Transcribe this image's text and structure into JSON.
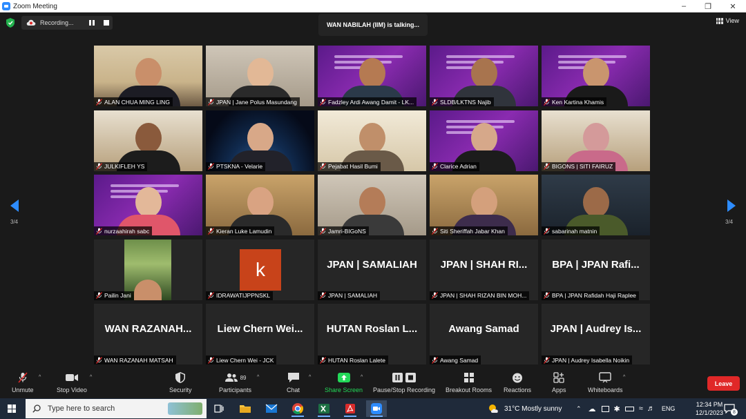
{
  "window": {
    "title": "Zoom Meeting",
    "controls": [
      "–",
      "❐",
      "✕"
    ]
  },
  "top": {
    "recording_label": "Recording...",
    "talking_label": "WAN NABILAH (IIM) is talking...",
    "view_label": "View",
    "page_indicator": "3/4"
  },
  "tiles": [
    {
      "name": "ALAN CHUA MING LING",
      "style": "office",
      "skin": "#c98f6a",
      "shirt": "#1c1c24"
    },
    {
      "name": "JPAN | Jane Polus Masundang",
      "style": "beige",
      "skin": "#e2b896",
      "shirt": "#2a2a2a"
    },
    {
      "name": "Fadzley Ardi Awang Damit - LK...",
      "style": "purple",
      "skin": "#b57a52",
      "shirt": "#2b3a4a"
    },
    {
      "name": "SLDB/LKTNS Najib",
      "style": "purple",
      "skin": "#a8744e",
      "shirt": "#30343c"
    },
    {
      "name": "Ken Kartina Khamis",
      "style": "purple",
      "skin": "#c9956e",
      "shirt": "#1a1a1a"
    },
    {
      "name": "JULKIFLEH YS",
      "style": "room",
      "skin": "#8a5a3c",
      "shirt": "#1c1c1c"
    },
    {
      "name": "PTSKNA - Velarie",
      "style": "earth",
      "skin": "#d8a888",
      "shirt": "#22222a"
    },
    {
      "name": "Pejabat Hasil Bumi",
      "style": "bright",
      "skin": "#c08f6a",
      "shirt": "#6a5a48"
    },
    {
      "name": "Clarice Adrian",
      "style": "purple",
      "skin": "#d6a88a",
      "shirt": "#1c1c1c"
    },
    {
      "name": "BIGONS | SITI FAIRUZ",
      "style": "room",
      "skin": "#d49a9a",
      "shirt": "#c96a8a"
    },
    {
      "name": "nurzaahirah sabc",
      "style": "purple",
      "skin": "#e3b899",
      "shirt": "#e0566a"
    },
    {
      "name": "Kieran Luke Lamudin",
      "style": "warm",
      "skin": "#d9a382",
      "shirt": "#2a2a2a"
    },
    {
      "name": "Jamri-BIGoNS",
      "style": "beige",
      "skin": "#b47c58",
      "shirt": "#3a3a3a"
    },
    {
      "name": "Siti Sheriffah Jabar Khan",
      "style": "warm",
      "skin": "#d4a07c",
      "shirt": "#3d2c4c"
    },
    {
      "name": "sabarinah matnin",
      "style": "dark",
      "skin": "#9c6a48",
      "shirt": "#4a5a2a"
    }
  ],
  "placeholder_tiles": [
    {
      "display": "",
      "name": "Pailin Jani",
      "kind": "photo"
    },
    {
      "display": "k",
      "name": "IDRAWATIJPPNSKL",
      "kind": "letter"
    },
    {
      "display": "JPAN | SAMALIAH",
      "name": "JPAN | SAMALIAH",
      "kind": "text"
    },
    {
      "display": "JPAN | SHAH RI...",
      "name": "JPAN | SHAH RIZAN BIN MOH...",
      "kind": "text"
    },
    {
      "display": "BPA | JPAN Rafi...",
      "name": "BPA | JPAN Rafidah Haji Raplee",
      "kind": "text"
    },
    {
      "display": "WAN  RAZANAH...",
      "name": "WAN RAZANAH MATSAH",
      "kind": "text"
    },
    {
      "display": "Liew Chern Wei...",
      "name": "Liew Chern Wei - JCK",
      "kind": "text"
    },
    {
      "display": "HUTAN Roslan L...",
      "name": "HUTAN Roslan Lalete",
      "kind": "text"
    },
    {
      "display": "Awang Samad",
      "name": "Awang Samad",
      "kind": "text"
    },
    {
      "display": "JPAN | Audrey Is...",
      "name": "JPAN | Audrey Isabella Noikin",
      "kind": "text"
    }
  ],
  "toolbar": {
    "unmute": "Unmute",
    "stop_video": "Stop Video",
    "security": "Security",
    "participants": "Participants",
    "participants_count": "89",
    "chat": "Chat",
    "share_screen": "Share Screen",
    "pause_stop_recording": "Pause/Stop Recording",
    "breakout_rooms": "Breakout Rooms",
    "reactions": "Reactions",
    "apps": "Apps",
    "whiteboards": "Whiteboards",
    "leave": "Leave"
  },
  "taskbar": {
    "search_placeholder": "Type here to search",
    "weather": "31°C  Mostly sunny",
    "language": "ENG",
    "time": "12:34 PM",
    "date": "12/1/2023",
    "notification_count": "8"
  },
  "colors": {
    "zoom_blue": "#2d8cff",
    "leave_red": "#e02828",
    "share_green": "#23d959",
    "mute_red": "#e02828"
  }
}
